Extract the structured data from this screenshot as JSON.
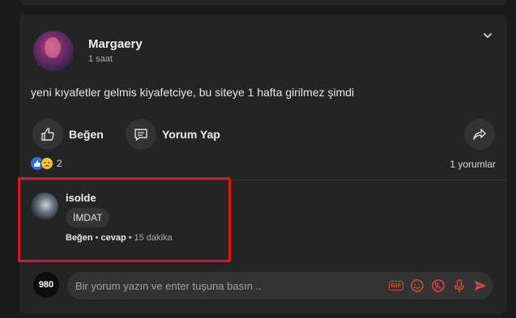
{
  "post": {
    "author": "Margaery",
    "time": "1 saat",
    "text": "yeni kıyafetler gelmis kiyafetciye, bu siteye 1 hafta girilmez şimdi",
    "actions": {
      "like_label": "Beğen",
      "comment_label": "Yorum Yap"
    },
    "reactions": {
      "count": "2",
      "types": [
        "like",
        "sad"
      ]
    },
    "comment_count_label": "1 yorumlar"
  },
  "comment": {
    "author": "isolde",
    "text": "İMDAT",
    "like_label": "Beğen",
    "separator": "•",
    "reply_label": "cevap",
    "time": "15 dakika"
  },
  "composer": {
    "avatar_text": "980",
    "placeholder": "Bir yorum yazın ve enter tuşuna basın ..",
    "gif_label": "GIF"
  },
  "colors": {
    "background": "#1a1a1a",
    "card": "#242424",
    "button_bg": "#333333",
    "accent_red": "#e2453c",
    "highlight": "#e01414"
  }
}
